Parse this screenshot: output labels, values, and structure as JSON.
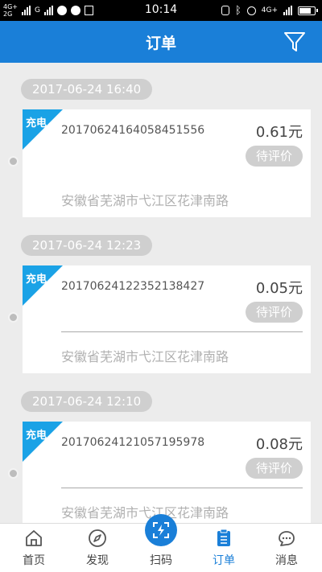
{
  "status_bar": {
    "net_top": "4G+",
    "net_bottom": "2G",
    "net_g": "G",
    "time": "10:14",
    "right_net": "4G+"
  },
  "header": {
    "title": "订单",
    "filter_icon": "filter-icon"
  },
  "orders": [
    {
      "date": "2017-06-24 16:40",
      "tag": "充电",
      "order_no": "20170624164058451556",
      "amount": "0.61元",
      "status": "待评价",
      "address": "安徽省芜湖市弋江区花津南路"
    },
    {
      "date": "2017-06-24 12:23",
      "tag": "充电",
      "order_no": "20170624122352138427",
      "amount": "0.05元",
      "status": "待评价",
      "address": "安徽省芜湖市弋江区花津南路"
    },
    {
      "date": "2017-06-24 12:10",
      "tag": "充电",
      "order_no": "20170624121057195978",
      "amount": "0.08元",
      "status": "待评价",
      "address": "安徽省芜湖市弋江区花津南路"
    }
  ],
  "bottom_nav": {
    "items": [
      {
        "label": "首页",
        "icon": "home-icon"
      },
      {
        "label": "发现",
        "icon": "compass-icon"
      },
      {
        "label": "扫码",
        "icon": "scan-icon"
      },
      {
        "label": "订单",
        "icon": "order-list-icon",
        "active": true
      },
      {
        "label": "消息",
        "icon": "message-icon"
      }
    ]
  },
  "colors": {
    "primary": "#1a7fd8",
    "ribbon": "#1aa2e6",
    "pill": "#cfcfcf"
  }
}
